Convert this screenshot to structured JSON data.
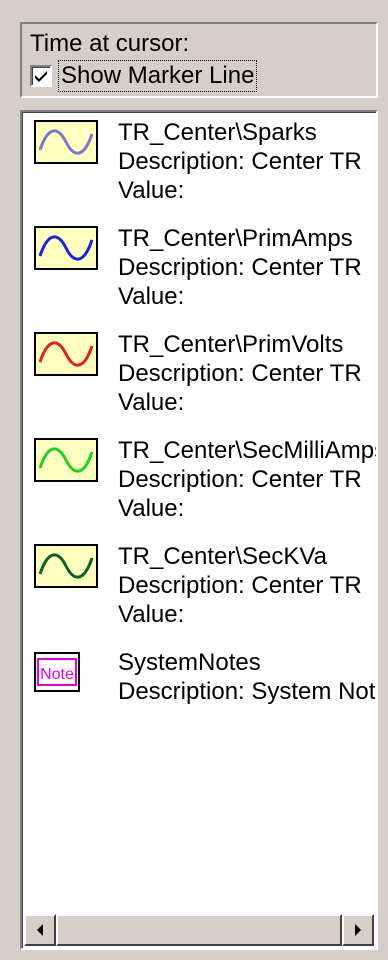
{
  "cursor_panel": {
    "time_label": "Time at cursor:",
    "show_marker_label": "Show Marker Line",
    "show_marker_checked": true
  },
  "items": [
    {
      "icon": "sine-wave-icon",
      "wave_color": "#7a7ac8",
      "name": "TR_Center\\Sparks",
      "description": "Description: Center TR",
      "value": "Value:"
    },
    {
      "icon": "sine-wave-icon",
      "wave_color": "#2020e0",
      "name": "TR_Center\\PrimAmps",
      "description": "Description: Center TR",
      "value": "Value:"
    },
    {
      "icon": "sine-wave-icon",
      "wave_color": "#e02020",
      "name": "TR_Center\\PrimVolts",
      "description": "Description: Center TR",
      "value": "Value:"
    },
    {
      "icon": "sine-wave-icon",
      "wave_color": "#20d020",
      "name": "TR_Center\\SecMilliAmps",
      "description": "Description: Center TR",
      "value": "Value:"
    },
    {
      "icon": "sine-wave-icon",
      "wave_color": "#106020",
      "name": "TR_Center\\SecKVa",
      "description": "Description: Center TR",
      "value": "Value:"
    },
    {
      "icon": "note-icon",
      "note_text": "Note",
      "note_color": "#e000e0",
      "name": "SystemNotes",
      "description": "Description: System Notebook"
    }
  ],
  "colors": {
    "icon_background": "#ffffc0",
    "note_background": "#ffffff"
  }
}
